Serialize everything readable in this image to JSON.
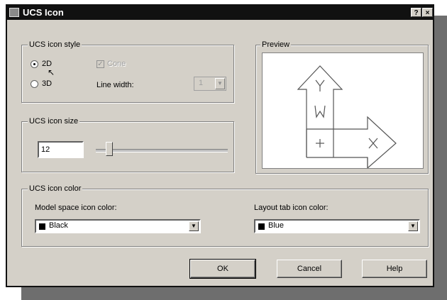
{
  "window": {
    "title": "UCS Icon",
    "help_button": "?",
    "close_button": "×"
  },
  "style_group": {
    "legend": "UCS icon style",
    "radio_2d": {
      "label": "2D",
      "selected": true
    },
    "radio_3d": {
      "label": "3D",
      "selected": false
    },
    "cone": {
      "label": "Cone",
      "checked": true,
      "enabled": false
    },
    "line_width": {
      "label": "Line width:",
      "value": "1",
      "enabled": false
    }
  },
  "preview": {
    "label": "Preview"
  },
  "size_group": {
    "legend": "UCS icon size",
    "value": "12"
  },
  "color_group": {
    "legend": "UCS icon color",
    "model_label": "Model space icon color:",
    "model_value": "Black",
    "model_color": "#000000",
    "layout_label": "Layout tab icon color:",
    "layout_value": "Blue",
    "layout_color": "#000000"
  },
  "buttons": {
    "ok": "OK",
    "cancel": "Cancel",
    "help": "Help"
  }
}
